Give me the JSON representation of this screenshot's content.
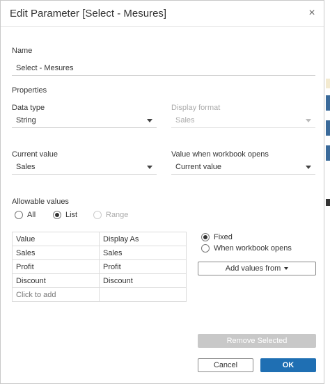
{
  "dialog": {
    "title": "Edit Parameter [Select -  Mesures]",
    "close_glyph": "×"
  },
  "name": {
    "label": "Name",
    "value": "Select -  Mesures"
  },
  "properties": {
    "label": "Properties",
    "data_type": {
      "label": "Data type",
      "value": "String"
    },
    "display_format": {
      "label": "Display format",
      "value": "Sales"
    },
    "current_value": {
      "label": "Current value",
      "value": "Sales"
    },
    "workbook_opens": {
      "label": "Value when workbook opens",
      "value": "Current value"
    }
  },
  "allowable": {
    "label": "Allowable values",
    "options": [
      {
        "label": "All",
        "checked": false,
        "enabled": true
      },
      {
        "label": "List",
        "checked": true,
        "enabled": true
      },
      {
        "label": "Range",
        "checked": false,
        "enabled": false
      }
    ]
  },
  "list_table": {
    "headers": [
      "Value",
      "Display As"
    ],
    "rows": [
      [
        "Sales",
        "Sales"
      ],
      [
        "Profit",
        "Profit"
      ],
      [
        "Discount",
        "Discount"
      ]
    ],
    "add_row_label": "Click to add"
  },
  "list_source": {
    "fixed_label": "Fixed",
    "opens_label": "When workbook opens",
    "add_values_label": "Add values from"
  },
  "footer": {
    "remove_label": "Remove Selected",
    "cancel_label": "Cancel",
    "ok_label": "OK"
  },
  "colors": {
    "primary": "#1f6fb3",
    "disabled": "#c8c8c8"
  }
}
